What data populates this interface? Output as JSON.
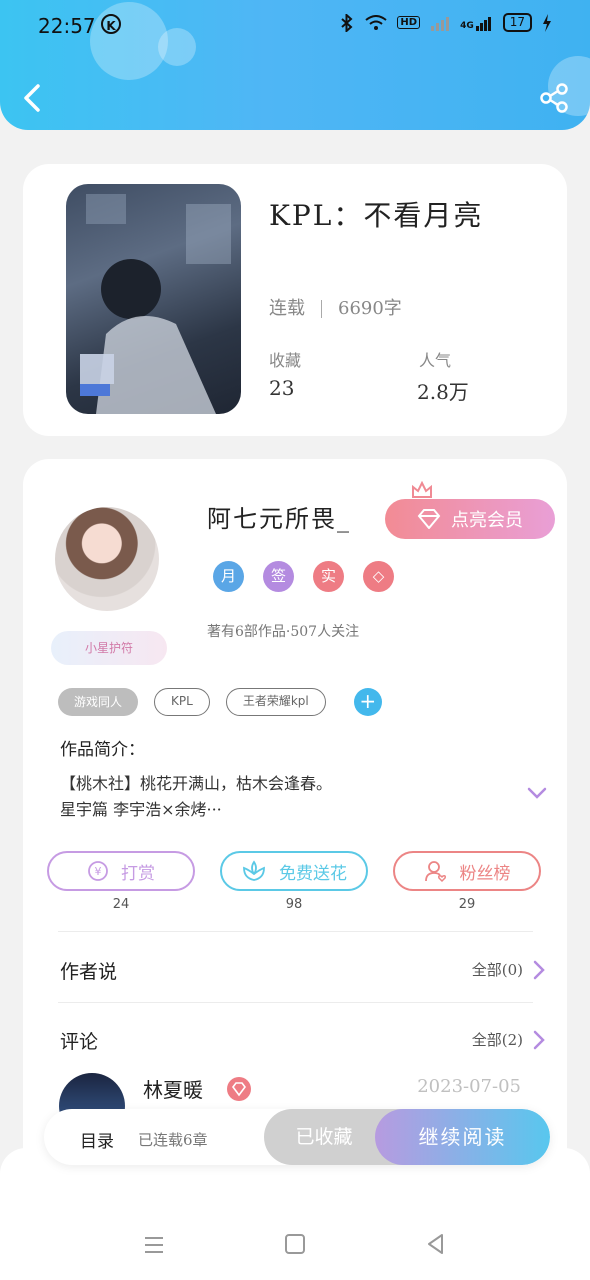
{
  "status_bar": {
    "time": "22:57",
    "k_icon": "K",
    "hd": "HD",
    "net": "4G",
    "battery": "17"
  },
  "header": {
    "back_icon": "chevron-left-icon",
    "share_icon": "share-icon"
  },
  "book": {
    "title": "KPL：不看月亮",
    "status": "连载",
    "word_count": "6690字",
    "stats": [
      {
        "label": "收藏",
        "value": "23"
      },
      {
        "label": "人气",
        "value": "2.8万"
      }
    ]
  },
  "author": {
    "name": "阿七元所畏_",
    "vip_button": "点亮会员",
    "guard_badge": "小星护符",
    "badges": [
      "月",
      "签",
      "实",
      "◇"
    ],
    "works_info": "著有6部作品·507人关注",
    "tags": [
      "游戏同人",
      "KPL",
      "王者荣耀kpl"
    ],
    "add_tag": "+"
  },
  "intro": {
    "title": "作品简介：",
    "line1": "【桃木社】桃花开满山，枯木会逢春。",
    "line2": "星宇篇 李宇浩×余烤···"
  },
  "actions": [
    {
      "label": "打赏",
      "count": "24",
      "color": "#c69be3"
    },
    {
      "label": "免费送花",
      "count": "98",
      "color": "#5bc9e6"
    },
    {
      "label": "粉丝榜",
      "count": "29",
      "color": "#ec8585"
    }
  ],
  "author_says": {
    "title": "作者说",
    "link": "全部(0)"
  },
  "comments": {
    "title": "评论",
    "link": "全部(2)",
    "first": {
      "name": "林夏暖",
      "date": "2023-07-05"
    }
  },
  "bottom_bar": {
    "toc": "目录",
    "chapters": "已连载6章",
    "collected": "已收藏",
    "continue": "继续阅读"
  }
}
